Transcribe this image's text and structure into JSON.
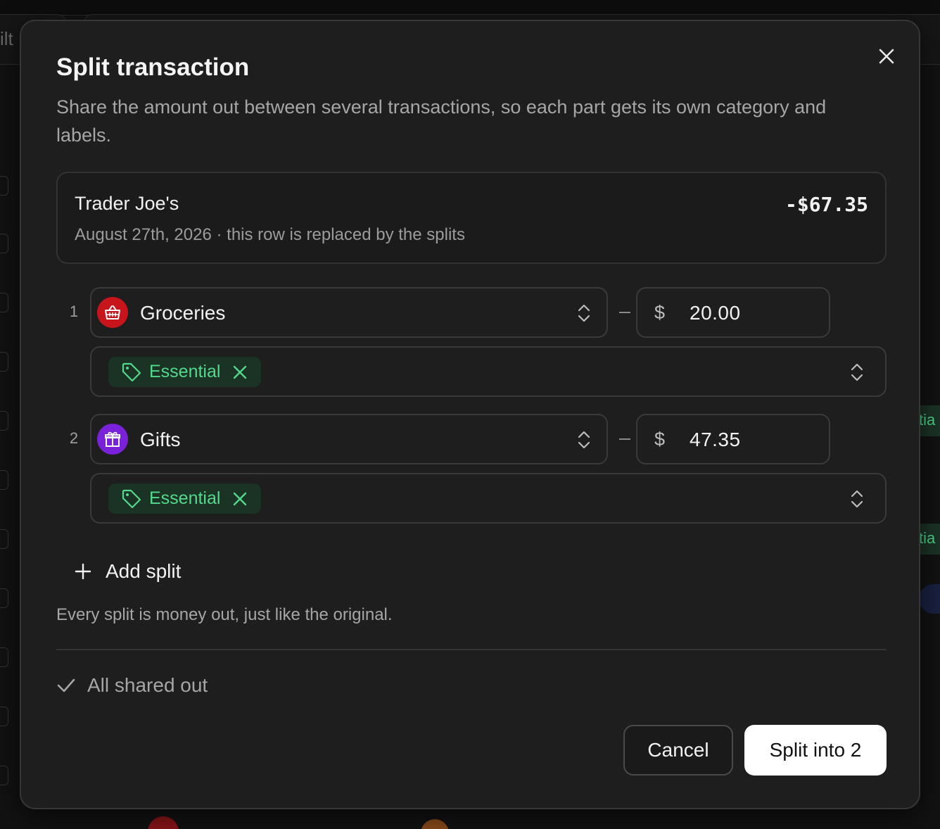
{
  "modal": {
    "title": "Split transaction",
    "subtitle": "Share the amount out between several transactions, so each part gets its own category and labels.",
    "original": {
      "merchant": "Trader Joe's",
      "amount": "-$67.35",
      "meta": "August 27th, 2026 · this row is replaced by the splits"
    },
    "splits": [
      {
        "index": "1",
        "category": "Groceries",
        "category_icon": "basket-icon",
        "category_color": "#c8151b",
        "currency": "$",
        "amount": "20.00",
        "tag": "Essential"
      },
      {
        "index": "2",
        "category": "Gifts",
        "category_icon": "gift-icon",
        "category_color": "#7a22d9",
        "currency": "$",
        "amount": "47.35",
        "tag": "Essential"
      }
    ],
    "add_split_label": "Add split",
    "helper_text": "Every split is money out, just like the original.",
    "status_text": "All shared out",
    "cancel_label": "Cancel",
    "confirm_label": "Split into 2"
  },
  "colors": {
    "tag_green": "#52d98b",
    "tag_bg": "#1b3325"
  }
}
